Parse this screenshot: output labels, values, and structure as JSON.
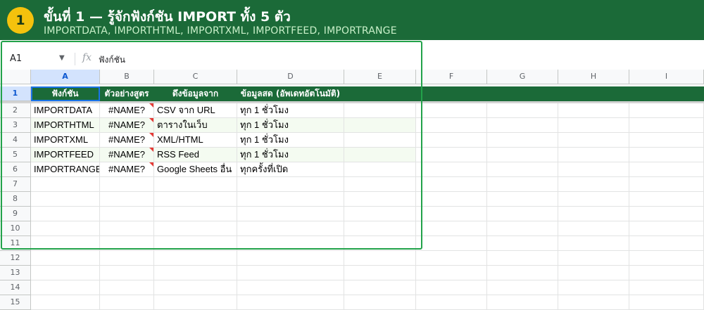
{
  "banner": {
    "step_number": "1",
    "title": "ขั้นที่ 1 — รู้จักฟังก์ชัน IMPORT ทั้ง 5 ตัว",
    "subtitle": "IMPORTDATA, IMPORTHTML, IMPORTXML, IMPORTFEED, IMPORTRANGE"
  },
  "formula_bar": {
    "name_box": "A1",
    "fx_icon": "fx-icon",
    "formula": "ฟังก์ชัน"
  },
  "sheet": {
    "columns": [
      "A",
      "B",
      "C",
      "D",
      "E",
      "F",
      "G",
      "H",
      "I"
    ],
    "rows": [
      "1",
      "2",
      "3",
      "4",
      "5",
      "6",
      "7",
      "8",
      "9",
      "10",
      "11",
      "12",
      "13",
      "14",
      "15"
    ],
    "header_row": [
      "ฟังก์ชัน",
      "ตัวอย่างสูตร",
      "ดึงข้อมูลจาก",
      "ข้อมูลสด (อัพเดทอัตโนมัติ)"
    ],
    "data_rows": [
      [
        "IMPORTDATA",
        "#NAME?",
        "CSV จาก URL",
        "ทุก 1 ชั่วโมง"
      ],
      [
        "IMPORTHTML",
        "#NAME?",
        "ตารางในเว็บ",
        "ทุก 1 ชั่วโมง"
      ],
      [
        "IMPORTXML",
        "#NAME?",
        "XML/HTML",
        "ทุก 1 ชั่วโมง"
      ],
      [
        "IMPORTFEED",
        "#NAME?",
        "RSS Feed",
        "ทุก 1 ชั่วโมง"
      ],
      [
        "IMPORTRANGE",
        "#NAME?",
        "Google Sheets อื่น",
        "ทุกครั้งที่เปิด"
      ]
    ]
  },
  "colors": {
    "banner_green": "#1b6a38",
    "badge_yellow": "#f4c20d",
    "highlight_green": "#22a24a",
    "error_red": "#e53935"
  }
}
